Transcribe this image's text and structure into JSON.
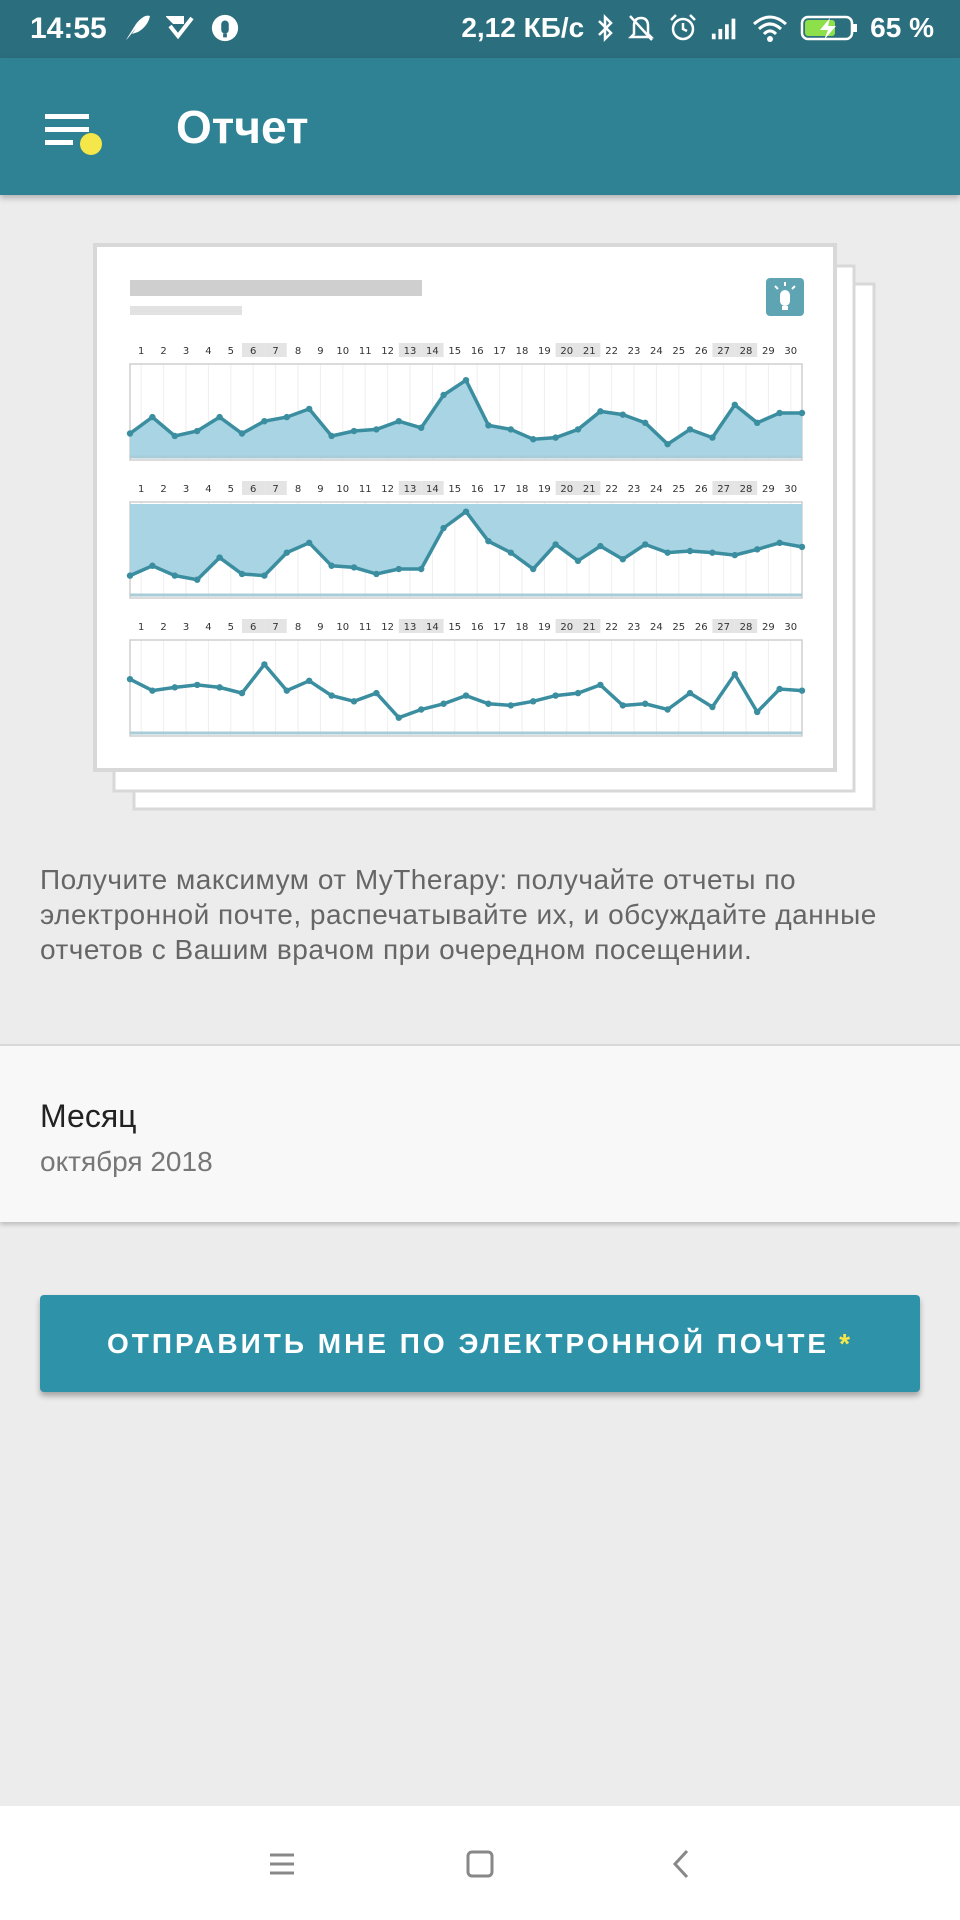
{
  "status_bar": {
    "time": "14:55",
    "speed": "2,12 КБ/с",
    "battery": "65 %",
    "icons": [
      "feather-icon",
      "check-icon",
      "app-icon",
      "bluetooth-icon",
      "silent-icon",
      "alarm-icon",
      "signal-icon",
      "wifi-icon",
      "battery-charging-icon"
    ]
  },
  "app_bar": {
    "title": "Отчет",
    "menu_icon": "menu-notification-icon",
    "accent_dot_color": "#f5e64a"
  },
  "report_preview": {
    "day_labels": [
      "1",
      "2",
      "3",
      "4",
      "5",
      "6",
      "7",
      "8",
      "9",
      "10",
      "11",
      "12",
      "13",
      "14",
      "15",
      "16",
      "17",
      "18",
      "19",
      "20",
      "21",
      "22",
      "23",
      "24",
      "25",
      "26",
      "27",
      "28",
      "29",
      "30"
    ],
    "highlighted_days": [
      6,
      7,
      13,
      14,
      20,
      21,
      27,
      28
    ],
    "logo_icon": "bulb-icon"
  },
  "description": "Получите максимум от MyTherapy: получайте отчеты по электронной почте, распечатывайте их, и обсуждайте данные отчетов с Вашим врачом при очередном посещении.",
  "month": {
    "label": "Месяц",
    "value": "октября 2018"
  },
  "send_button": {
    "label": "ОТПРАВИТЬ МНЕ ПО ЭЛЕКТРОННОЙ ПОЧТЕ",
    "asterisk": "*"
  },
  "nav_bar": {
    "icons": [
      "menu-icon",
      "home-icon",
      "back-icon"
    ]
  },
  "colors": {
    "status_bar": "#2b6f7e",
    "app_bar": "#2e8293",
    "button": "#2e93a8",
    "chart_line": "#3a8ea0",
    "chart_fill": "#a9d4e3"
  }
}
